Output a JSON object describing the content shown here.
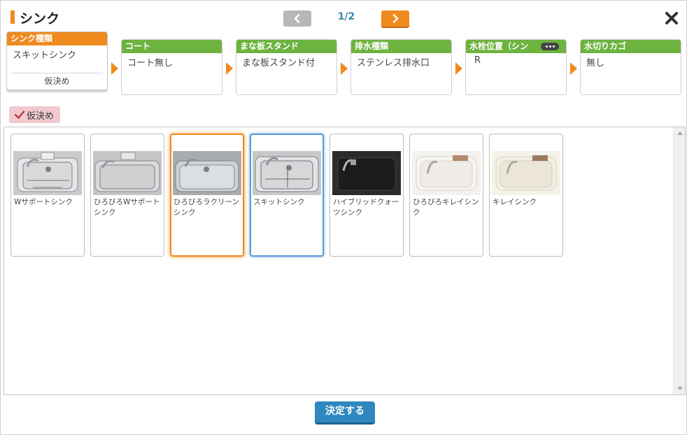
{
  "header": {
    "title": "シンク",
    "pager": "1/2"
  },
  "steps": [
    {
      "label": "シンク種類",
      "value": "スキットシンク",
      "tentative": "仮決め",
      "color": "#ef8a1e"
    },
    {
      "label": "コート",
      "value": "コート無し",
      "color": "#6db33f"
    },
    {
      "label": "まな板スタンド",
      "value": "まな板スタンド付",
      "color": "#6db33f"
    },
    {
      "label": "排水種類",
      "value": "ステンレス排水口",
      "color": "#6db33f"
    },
    {
      "label": "水栓位置（シン",
      "value": "R",
      "color": "#6db33f"
    },
    {
      "label": "水切りカゴ",
      "value": "無し",
      "color": "#6db33f"
    }
  ],
  "tentative_toggle": {
    "label": "仮決め"
  },
  "items": [
    {
      "label": "Wサポートシンク",
      "image": "stainless-sink-image"
    },
    {
      "label": "ひろびろWサポートシンク",
      "image": "stainless-sink-image"
    },
    {
      "label": "ひろびろラクリーンシンク",
      "image": "stainless-sink-image"
    },
    {
      "label": "スキットシンク",
      "image": "stainless-sink-image"
    },
    {
      "label": "ハイブリッドクォーツシンク",
      "image": "black-sink-image"
    },
    {
      "label": "ひろびろキレイシンク",
      "image": "white-sink-image"
    },
    {
      "label": "キレイシンク",
      "image": "white-sink-image"
    }
  ],
  "decide_button": {
    "label": "決定する"
  },
  "colors": {
    "accent": "#ef8a1e",
    "step_green": "#6db33f",
    "primary_button": "#2f88c0",
    "selected_border": "#5b9bd5"
  }
}
